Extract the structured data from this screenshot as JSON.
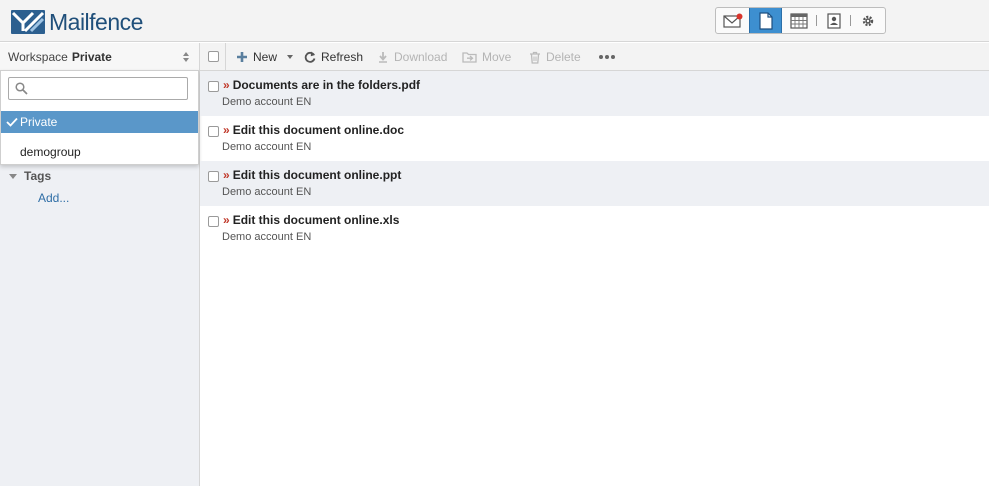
{
  "header": {
    "logo_text": "Mailfence",
    "apps": [
      {
        "name": "mail",
        "icon": "envelope-icon"
      },
      {
        "name": "documents",
        "icon": "document-icon",
        "active": true
      },
      {
        "name": "calendar",
        "icon": "calendar-icon"
      },
      {
        "name": "contacts",
        "icon": "contact-card-icon"
      },
      {
        "name": "settings",
        "icon": "gear-icon"
      }
    ],
    "accent_color": "#3d8fd0"
  },
  "sidebar": {
    "workspace_label": "Workspace",
    "workspace_value": "Private",
    "dropdown": {
      "search_placeholder": "",
      "items": [
        {
          "label": "Private",
          "selected": true
        },
        {
          "label": "demogroup",
          "selected": false
        }
      ]
    },
    "tags_title": "Tags",
    "tags_add": "Add..."
  },
  "toolbar": {
    "new_label": "New",
    "refresh_label": "Refresh",
    "download_label": "Download",
    "move_label": "Move",
    "delete_label": "Delete"
  },
  "documents": [
    {
      "name": "Documents are in the folders.pdf",
      "owner": "Demo account EN"
    },
    {
      "name": "Edit this document online.doc",
      "owner": "Demo account EN"
    },
    {
      "name": "Edit this document online.ppt",
      "owner": "Demo account EN"
    },
    {
      "name": "Edit this document online.xls",
      "owner": "Demo account EN"
    }
  ],
  "colors": {
    "selected_item_bg": "#5a97c9",
    "row_alt_bg": "#eef0f4",
    "link": "#2f6ea6",
    "marker": "#c0392b"
  }
}
